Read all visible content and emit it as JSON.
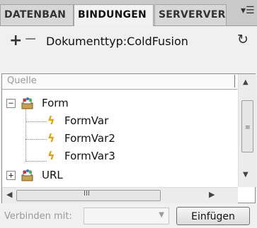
{
  "tabs": [
    {
      "label": "DATENBAN",
      "active": false
    },
    {
      "label": "BINDUNGEN",
      "active": true
    },
    {
      "label": "SERVERVER",
      "active": false
    }
  ],
  "toolbar": {
    "add_label": "+",
    "remove_label": "−",
    "doc_type": "Dokumenttyp:ColdFusion",
    "refresh_icon": "refresh-icon"
  },
  "tree": {
    "column_header": "Quelle",
    "nodes": [
      {
        "label": "Form",
        "expanded": true,
        "children": [
          "FormVar",
          "FormVar2",
          "FormVar3"
        ]
      },
      {
        "label": "URL",
        "expanded": false
      }
    ]
  },
  "bottom": {
    "bind_label": "Verbinden mit:",
    "bind_select_value": "",
    "insert_button": "Einfügen"
  },
  "colors": {
    "tab_bar": "#c9c9c9",
    "panel_bg": "#ffffff",
    "bolt": "#e0a400"
  }
}
